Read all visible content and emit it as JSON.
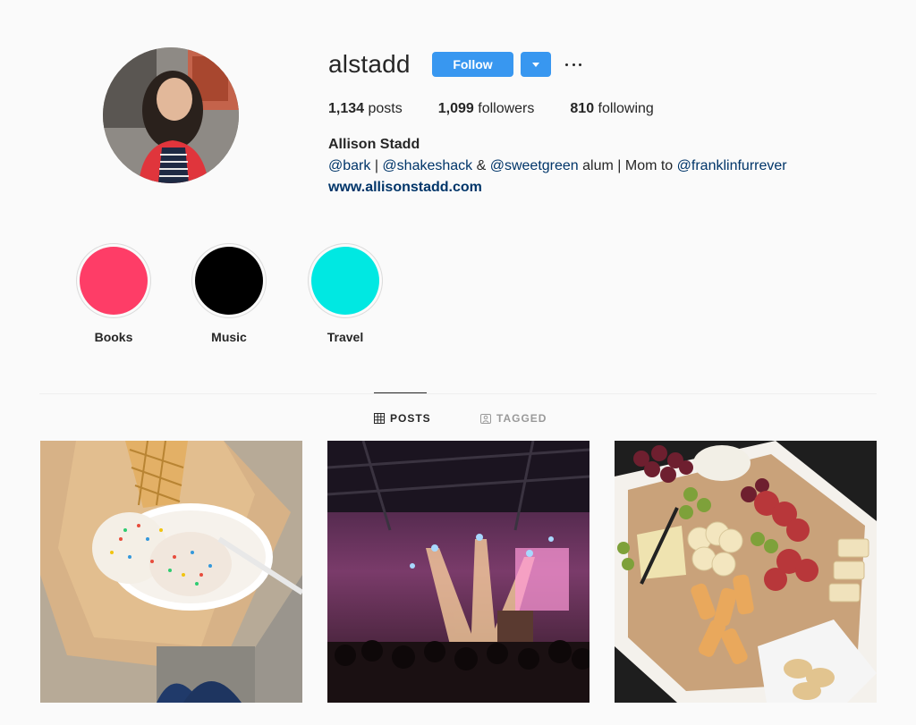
{
  "profile": {
    "username": "alstadd",
    "follow_label": "Follow",
    "stats": {
      "posts_count": "1,134",
      "posts_label": "posts",
      "followers_count": "1,099",
      "followers_label": "followers",
      "following_count": "810",
      "following_label": "following"
    },
    "full_name": "Allison Stadd",
    "bio": {
      "mention_1": "@bark",
      "sep_1": " | ",
      "mention_2": "@shakeshack",
      "sep_2": " & ",
      "mention_3": "@sweetgreen",
      "sep_3": " alum | Mom to ",
      "mention_4": "@franklinfurrever"
    },
    "website": "www.allisonstadd.com"
  },
  "highlights": [
    {
      "label": "Books",
      "color": "#fe3d67"
    },
    {
      "label": "Music",
      "color": "#000000"
    },
    {
      "label": "Travel",
      "color": "#00e8e2"
    }
  ],
  "tabs": {
    "posts": "POSTS",
    "tagged": "TAGGED"
  },
  "colors": {
    "accent": "#3897f0",
    "link": "#003569",
    "background": "#fafafa"
  },
  "posts": [
    {
      "subject": "ice cream cone with sprinkles"
    },
    {
      "subject": "concert stage lights"
    },
    {
      "subject": "cheese and charcuterie board"
    }
  ]
}
